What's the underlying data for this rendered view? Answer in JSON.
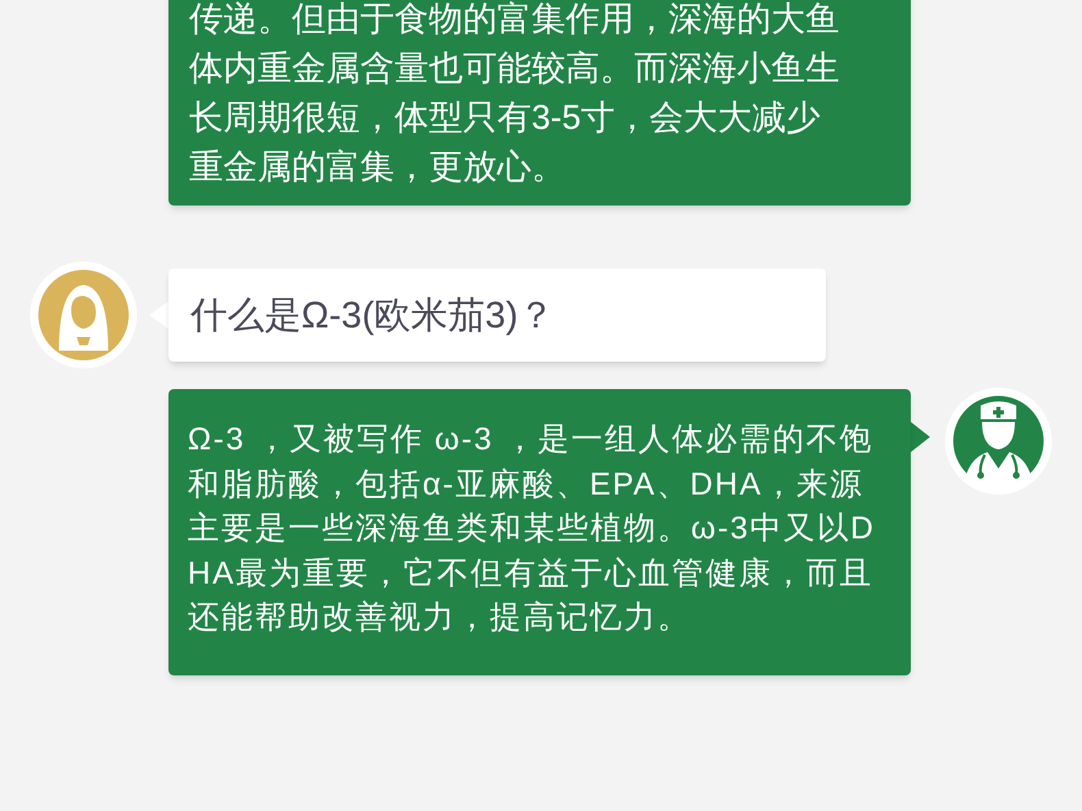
{
  "messages": [
    {
      "kind": "doctor",
      "avatar": false,
      "text": "传递。但由于食物的富集作用，深海的大鱼体内重金属含量也可能较高。而深海小鱼生长周期很短，体型只有3-5寸，会大大减少重金属的富集，更放心。"
    },
    {
      "kind": "user",
      "avatar": true,
      "text": "什么是Ω-3(欧米茄3)？"
    },
    {
      "kind": "doctor",
      "avatar": true,
      "text": "Ω-3 ，又被写作 ω-3 ，是一组人体必需的不饱和脂肪酸，包括α-亚麻酸、EPA、DHA，来源主要是一些深海鱼类和某些植物。ω-3中又以DHA最为重要，它不但有益于心血管健康，而且还能帮助改善视力，提高记忆力。"
    }
  ]
}
